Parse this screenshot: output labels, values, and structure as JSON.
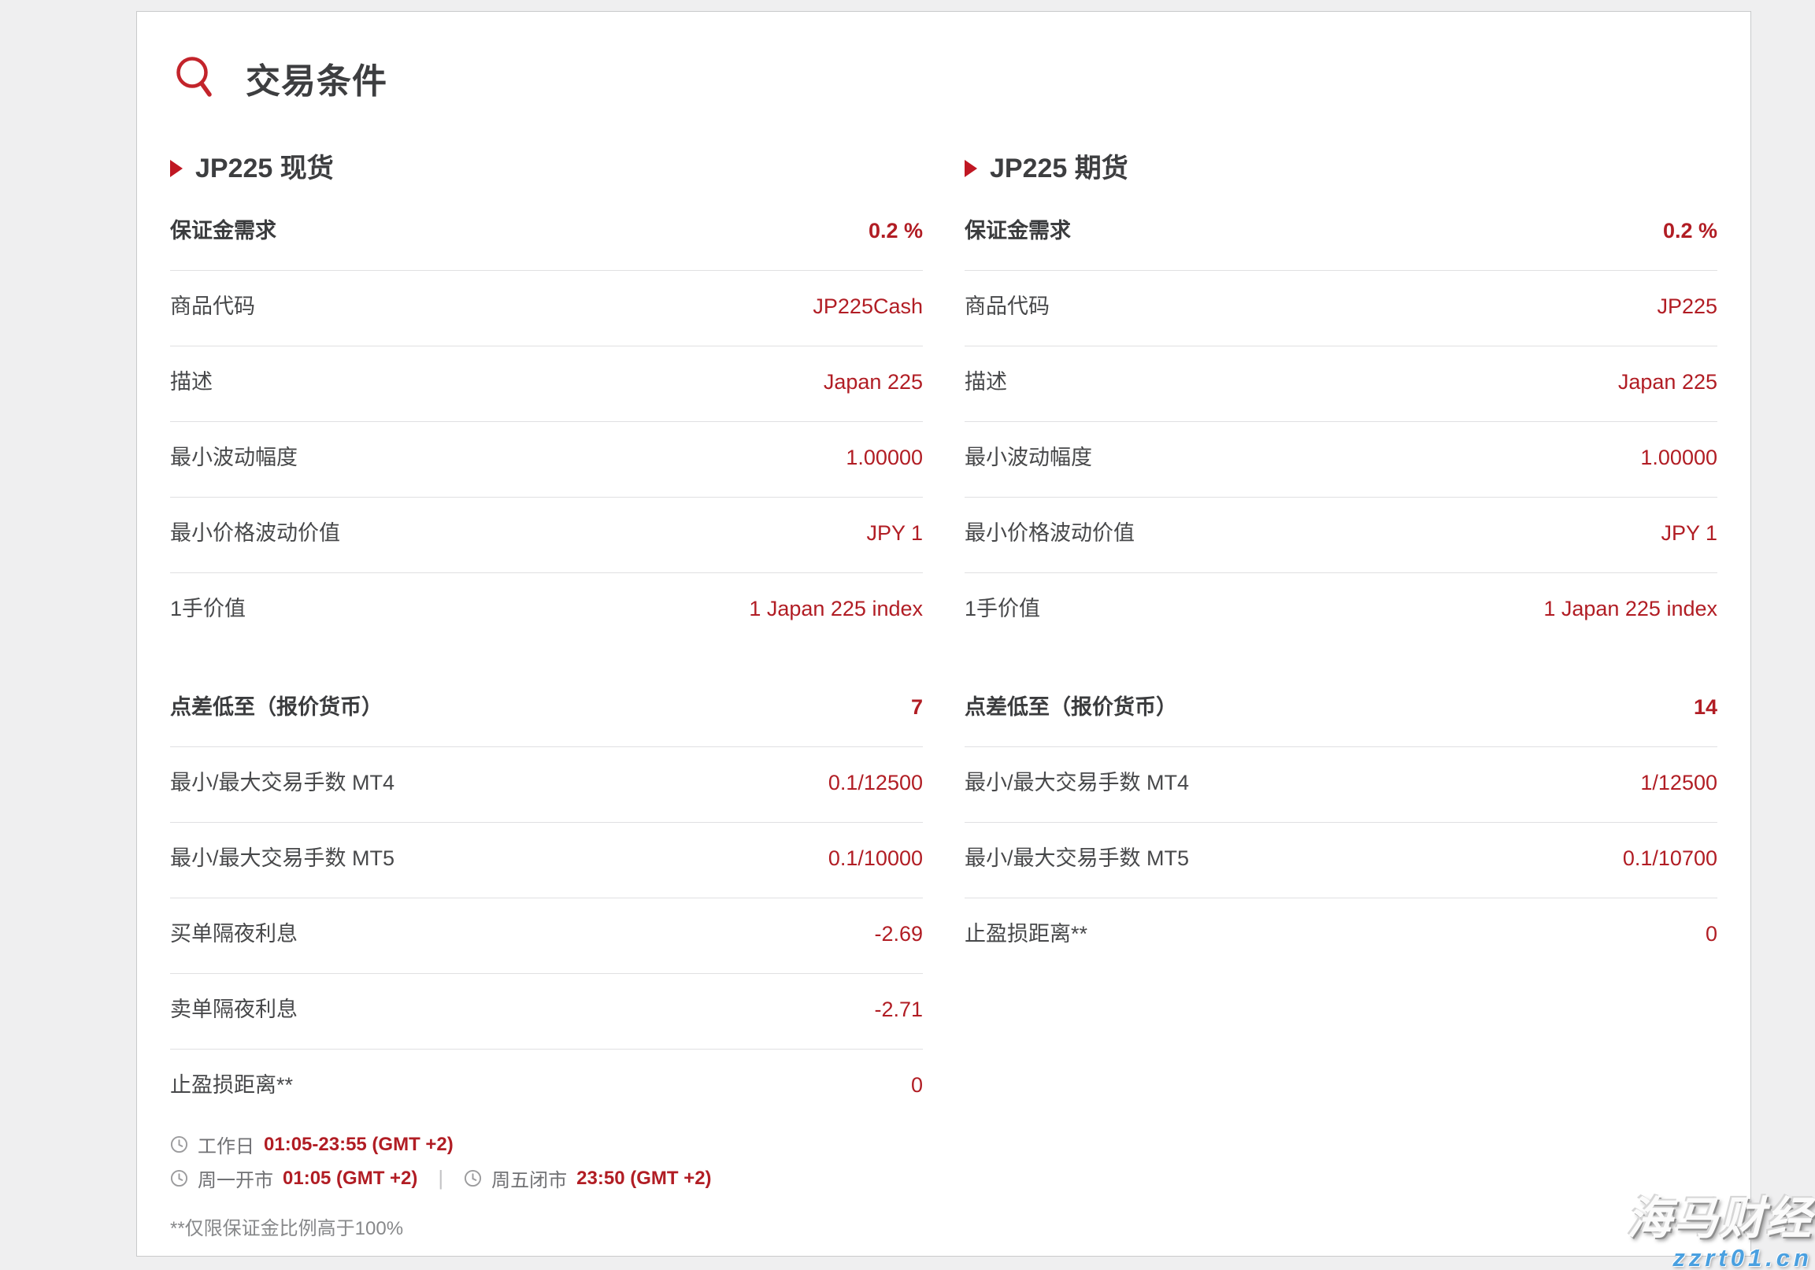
{
  "page": {
    "title": "交易条件",
    "footnote": "**仅限保证金比例高于100%"
  },
  "colors": {
    "accent_red": "#b11d24",
    "icon_red": "#c3242b",
    "watermark_blue": "#4aa0e0"
  },
  "icons": {
    "title": "search-icon",
    "bullet": "triangle-right-icon",
    "schedule": "clock-icon"
  },
  "schedule": {
    "weekday_label": "工作日",
    "weekday_time": "01:05-23:55 (GMT +2)",
    "monday_label": "周一开市",
    "monday_time": "01:05 (GMT +2)",
    "separator": "|",
    "friday_label": "周五闭市",
    "friday_time": "23:50 (GMT +2)"
  },
  "watermark": {
    "brand": "海马财经",
    "domain": "zzrt01.cn"
  },
  "columns": [
    {
      "header": "JP225 现货",
      "sections": [
        {
          "rows": [
            {
              "label": "保证金需求",
              "value": "0.2 %"
            },
            {
              "label": "商品代码",
              "value": "JP225Cash"
            },
            {
              "label": "描述",
              "value": "Japan 225"
            },
            {
              "label": "最小波动幅度",
              "value": "1.00000"
            },
            {
              "label": "最小价格波动价值",
              "value": "JPY 1"
            },
            {
              "label": "1手价值",
              "value": "1 Japan 225 index"
            }
          ]
        },
        {
          "rows": [
            {
              "label": "点差低至（报价货币）",
              "value": "7"
            },
            {
              "label": "最小/最大交易手数 MT4",
              "value": "0.1/12500"
            },
            {
              "label": "最小/最大交易手数 MT5",
              "value": "0.1/10000"
            },
            {
              "label": "买单隔夜利息",
              "value": "-2.69"
            },
            {
              "label": "卖单隔夜利息",
              "value": "-2.71"
            },
            {
              "label": "止盈损距离**",
              "value": "0"
            }
          ]
        }
      ]
    },
    {
      "header": "JP225 期货",
      "sections": [
        {
          "rows": [
            {
              "label": "保证金需求",
              "value": "0.2 %"
            },
            {
              "label": "商品代码",
              "value": "JP225"
            },
            {
              "label": "描述",
              "value": "Japan 225"
            },
            {
              "label": "最小波动幅度",
              "value": "1.00000"
            },
            {
              "label": "最小价格波动价值",
              "value": "JPY 1"
            },
            {
              "label": "1手价值",
              "value": "1 Japan 225 index"
            }
          ]
        },
        {
          "rows": [
            {
              "label": "点差低至（报价货币）",
              "value": "14"
            },
            {
              "label": "最小/最大交易手数 MT4",
              "value": "1/12500"
            },
            {
              "label": "最小/最大交易手数 MT5",
              "value": "0.1/10700"
            },
            {
              "label": "止盈损距离**",
              "value": "0"
            }
          ]
        }
      ]
    }
  ]
}
